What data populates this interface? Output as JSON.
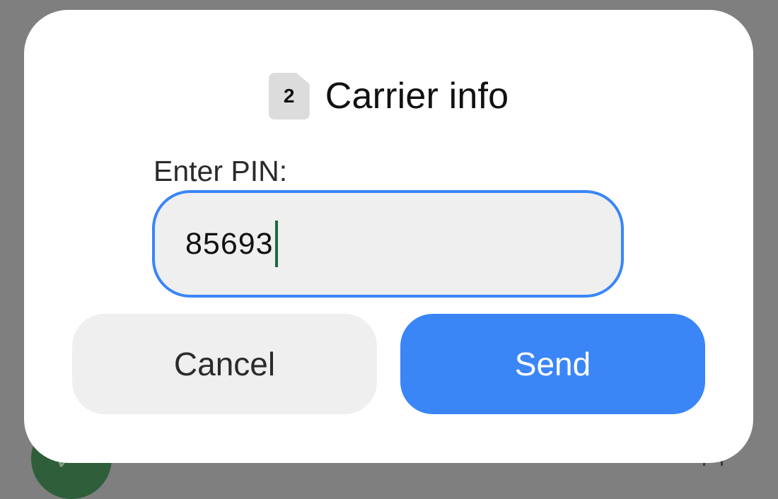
{
  "dialog": {
    "title": "Carrier info",
    "sim_badge": "2",
    "pin_label": "Enter PIN:",
    "pin_value": "85693",
    "cancel_label": "Cancel",
    "send_label": "Send"
  },
  "colors": {
    "accent": "#3a86f6",
    "field_background": "#efefef",
    "cursor": "#1a6b3f",
    "scrim": "#7f7f7f"
  },
  "icons": {
    "title_icon": "sim-card-icon"
  }
}
